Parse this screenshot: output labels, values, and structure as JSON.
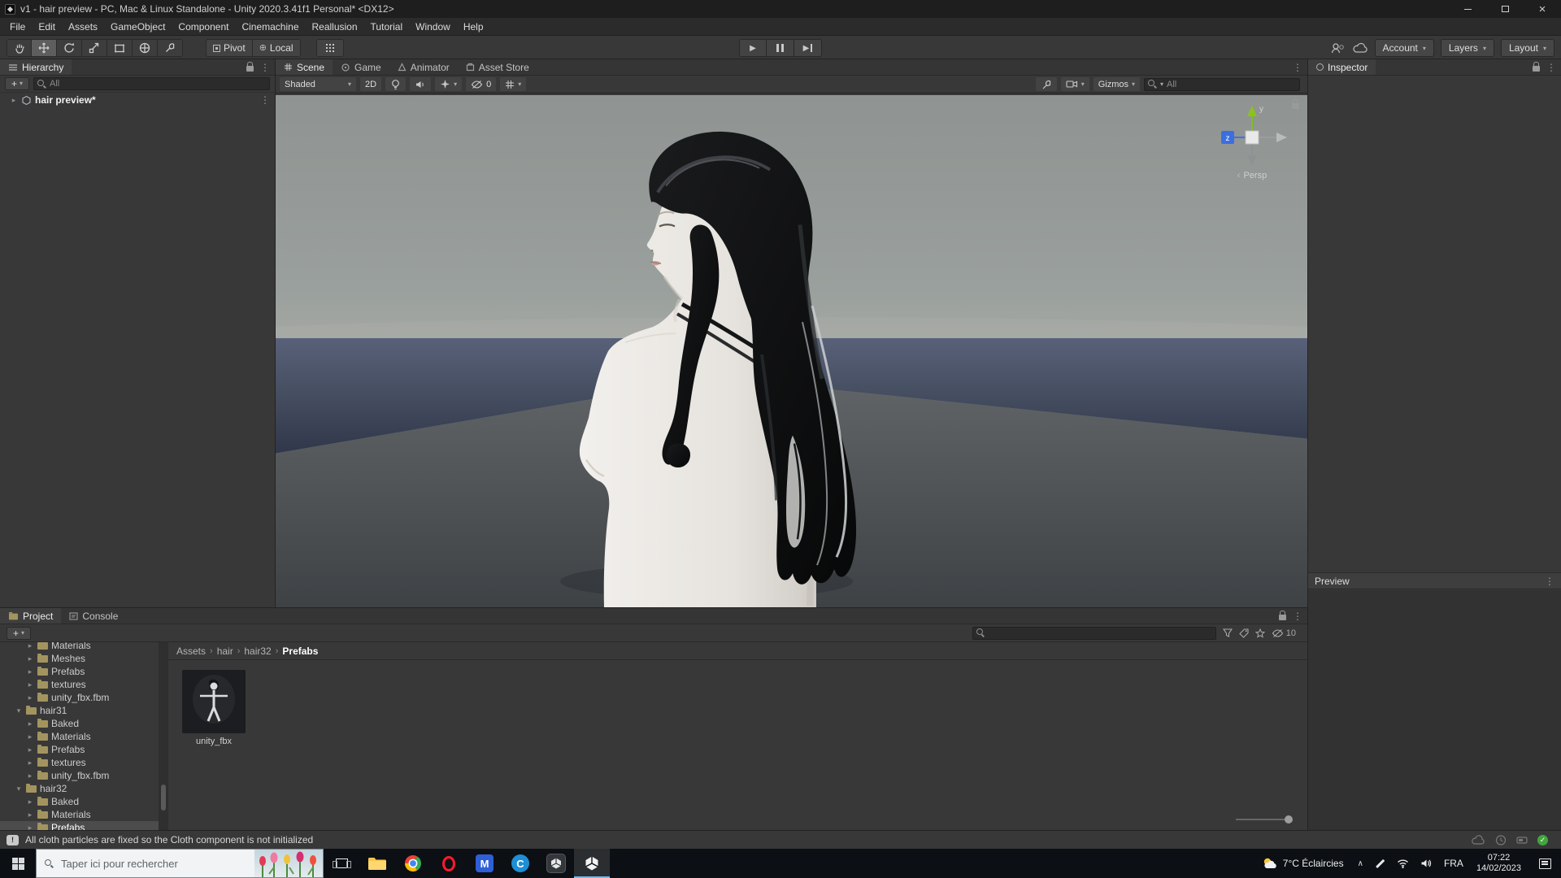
{
  "titlebar": {
    "title": "v1 - hair preview - PC, Mac & Linux Standalone - Unity 2020.3.41f1 Personal* <DX12>"
  },
  "menubar": {
    "items": [
      "File",
      "Edit",
      "Assets",
      "GameObject",
      "Component",
      "Cinemachine",
      "Reallusion",
      "Tutorial",
      "Window",
      "Help"
    ]
  },
  "toolbar": {
    "pivot": "Pivot",
    "local": "Local",
    "account": "Account",
    "layers": "Layers",
    "layout": "Layout"
  },
  "hierarchy": {
    "title": "Hierarchy",
    "search_text": "All",
    "scene_name": "hair preview*"
  },
  "scene_view": {
    "tab_scene": "Scene",
    "tab_game": "Game",
    "tab_animator": "Animator",
    "tab_asset_store": "Asset Store",
    "draw_mode": "Shaded",
    "mode_2d": "2D",
    "hidden_count": "0",
    "gizmos": "Gizmos",
    "search_text": "All",
    "gizmo_axis_y": "y",
    "gizmo_axis_z": "z",
    "projection": "Persp"
  },
  "inspector": {
    "title": "Inspector",
    "preview": "Preview"
  },
  "project": {
    "tab_project": "Project",
    "tab_console": "Console",
    "hidden_count": "10",
    "breadcrumb": [
      "Assets",
      "hair",
      "hair32",
      "Prefabs"
    ],
    "tree": [
      {
        "arrow": "▸",
        "label": "Materials"
      },
      {
        "arrow": "▸",
        "label": "Meshes"
      },
      {
        "arrow": "▸",
        "label": "Prefabs"
      },
      {
        "arrow": "▸",
        "label": "textures"
      },
      {
        "arrow": "▸",
        "label": "unity_fbx.fbm"
      },
      {
        "arrow": "▾",
        "label": "hair31"
      },
      {
        "arrow": "▸",
        "label": "Baked"
      },
      {
        "arrow": "▸",
        "label": "Materials"
      },
      {
        "arrow": "▸",
        "label": "Prefabs"
      },
      {
        "arrow": "▸",
        "label": "textures"
      },
      {
        "arrow": "▸",
        "label": "unity_fbx.fbm"
      },
      {
        "arrow": "▾",
        "label": "hair32"
      },
      {
        "arrow": "▸",
        "label": "Baked"
      },
      {
        "arrow": "▸",
        "label": "Materials"
      },
      {
        "arrow": "▸",
        "label": "Prefabs"
      }
    ],
    "asset_label": "unity_fbx"
  },
  "statusbar": {
    "message": "All cloth particles are fixed so the Cloth component is not initialized"
  },
  "taskbar": {
    "search_text": "Taper ici pour rechercher",
    "weather": "7°C Éclaircies",
    "language": "FRA",
    "time": "07:22",
    "date": "14/02/2023"
  }
}
